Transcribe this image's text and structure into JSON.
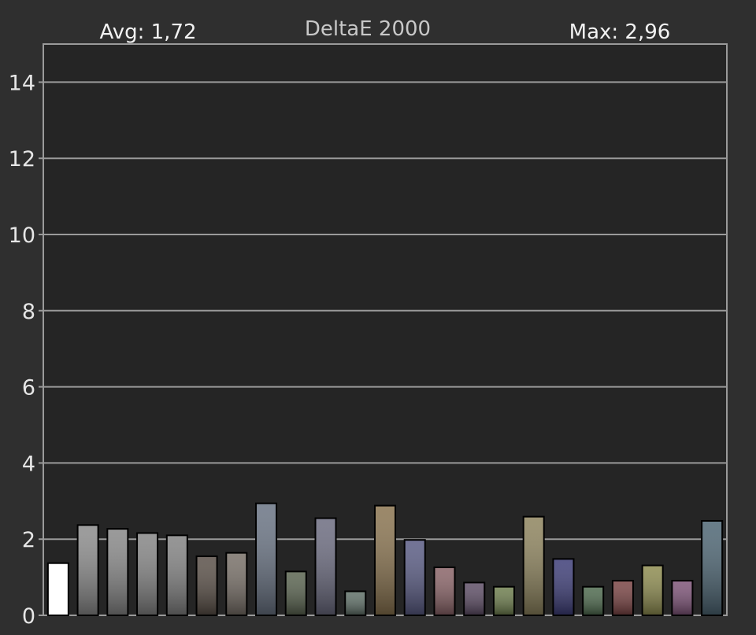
{
  "chart_data": {
    "type": "bar",
    "title": "DeltaE 2000",
    "avg_label": "Avg: 1,72",
    "max_label": "Max: 2,96",
    "ylim": [
      0,
      15
    ],
    "yticks": [
      0,
      2,
      4,
      6,
      8,
      10,
      12,
      14
    ],
    "grid": true,
    "values": [
      1.37,
      2.37,
      2.27,
      2.16,
      2.1,
      1.55,
      1.64,
      2.94,
      1.15,
      2.55,
      0.63,
      2.88,
      1.98,
      1.26,
      0.86,
      0.75,
      2.59,
      1.48,
      0.75,
      0.91,
      1.31,
      0.91,
      2.48
    ],
    "colors": [
      "#ffffff",
      "#8c8c8c",
      "#888888",
      "#858585",
      "#838383",
      "#5a5048",
      "#787068",
      "#6a7484",
      "#5a6450",
      "#6c6c80",
      "#607068",
      "#8a7450",
      "#5a5c84",
      "#8a6468",
      "#5e4e66",
      "#6e7e4e",
      "#8e845e",
      "#3e3e78",
      "#4e6a4e",
      "#7a4444",
      "#8e8c50",
      "#7e5478",
      "#4e6674"
    ]
  }
}
